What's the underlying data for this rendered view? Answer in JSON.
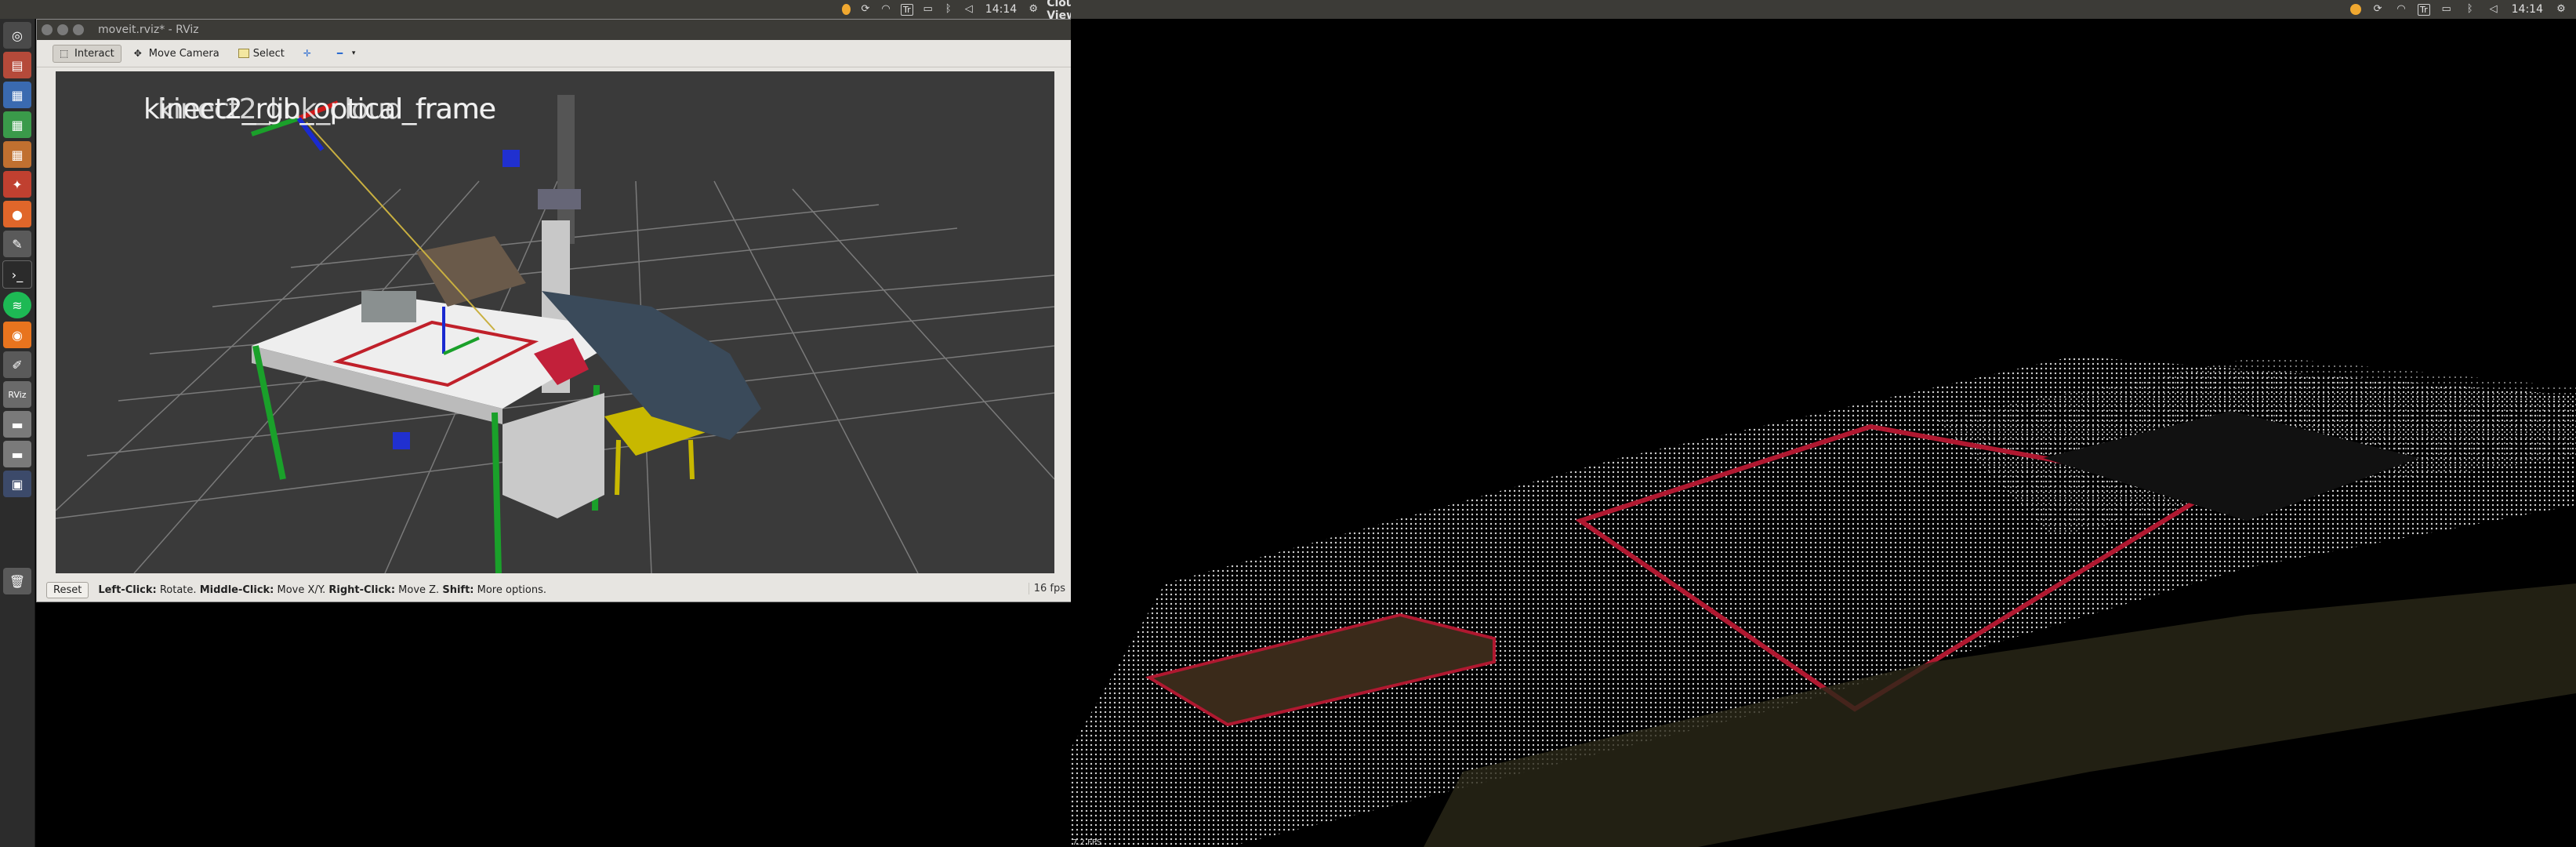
{
  "top_left": {
    "clock": "14:14",
    "app_title": "Cloud Viewer",
    "tray_box_label": "Tr"
  },
  "top_right": {
    "clock": "14:14",
    "tray_box_label": "Tr"
  },
  "launcher": {
    "items": [
      "dash-icon",
      "files-icon",
      "document-icon",
      "spreadsheet-icon",
      "presentation-icon",
      "settings-icon",
      "firefox-icon",
      "text-editor-icon",
      "terminal-icon",
      "spotify-icon",
      "ubuntu-software-icon",
      "pen-icon",
      "rviz-icon",
      "drive-icon",
      "drive-icon",
      "workspace-icon",
      "trash-icon"
    ]
  },
  "rviz": {
    "window_title": "moveit.rviz* - RViz",
    "toolbar": {
      "interact": "Interact",
      "move_camera": "Move Camera",
      "select": "Select"
    },
    "viewport": {
      "frame_label_a": "kinect2_rgb_optical_frame",
      "frame_label_b": "kinect2_link_cloud_frame"
    },
    "status": {
      "reset": "Reset",
      "left_click_key": "Left-Click:",
      "left_click_val": "Rotate.",
      "middle_click_key": "Middle-Click:",
      "middle_click_val": "Move X/Y.",
      "right_click_key": "Right-Click:",
      "right_click_val": "Move Z.",
      "shift_key": "Shift:",
      "shift_val": "More options.",
      "fps": "16 fps"
    }
  },
  "cloud_viewer": {
    "fps": "7.2 FPS"
  },
  "colors": {
    "panel_bg": "#3c3b37",
    "viewport_bg": "#3a3a3a",
    "accent_orange": "#f0a830"
  }
}
